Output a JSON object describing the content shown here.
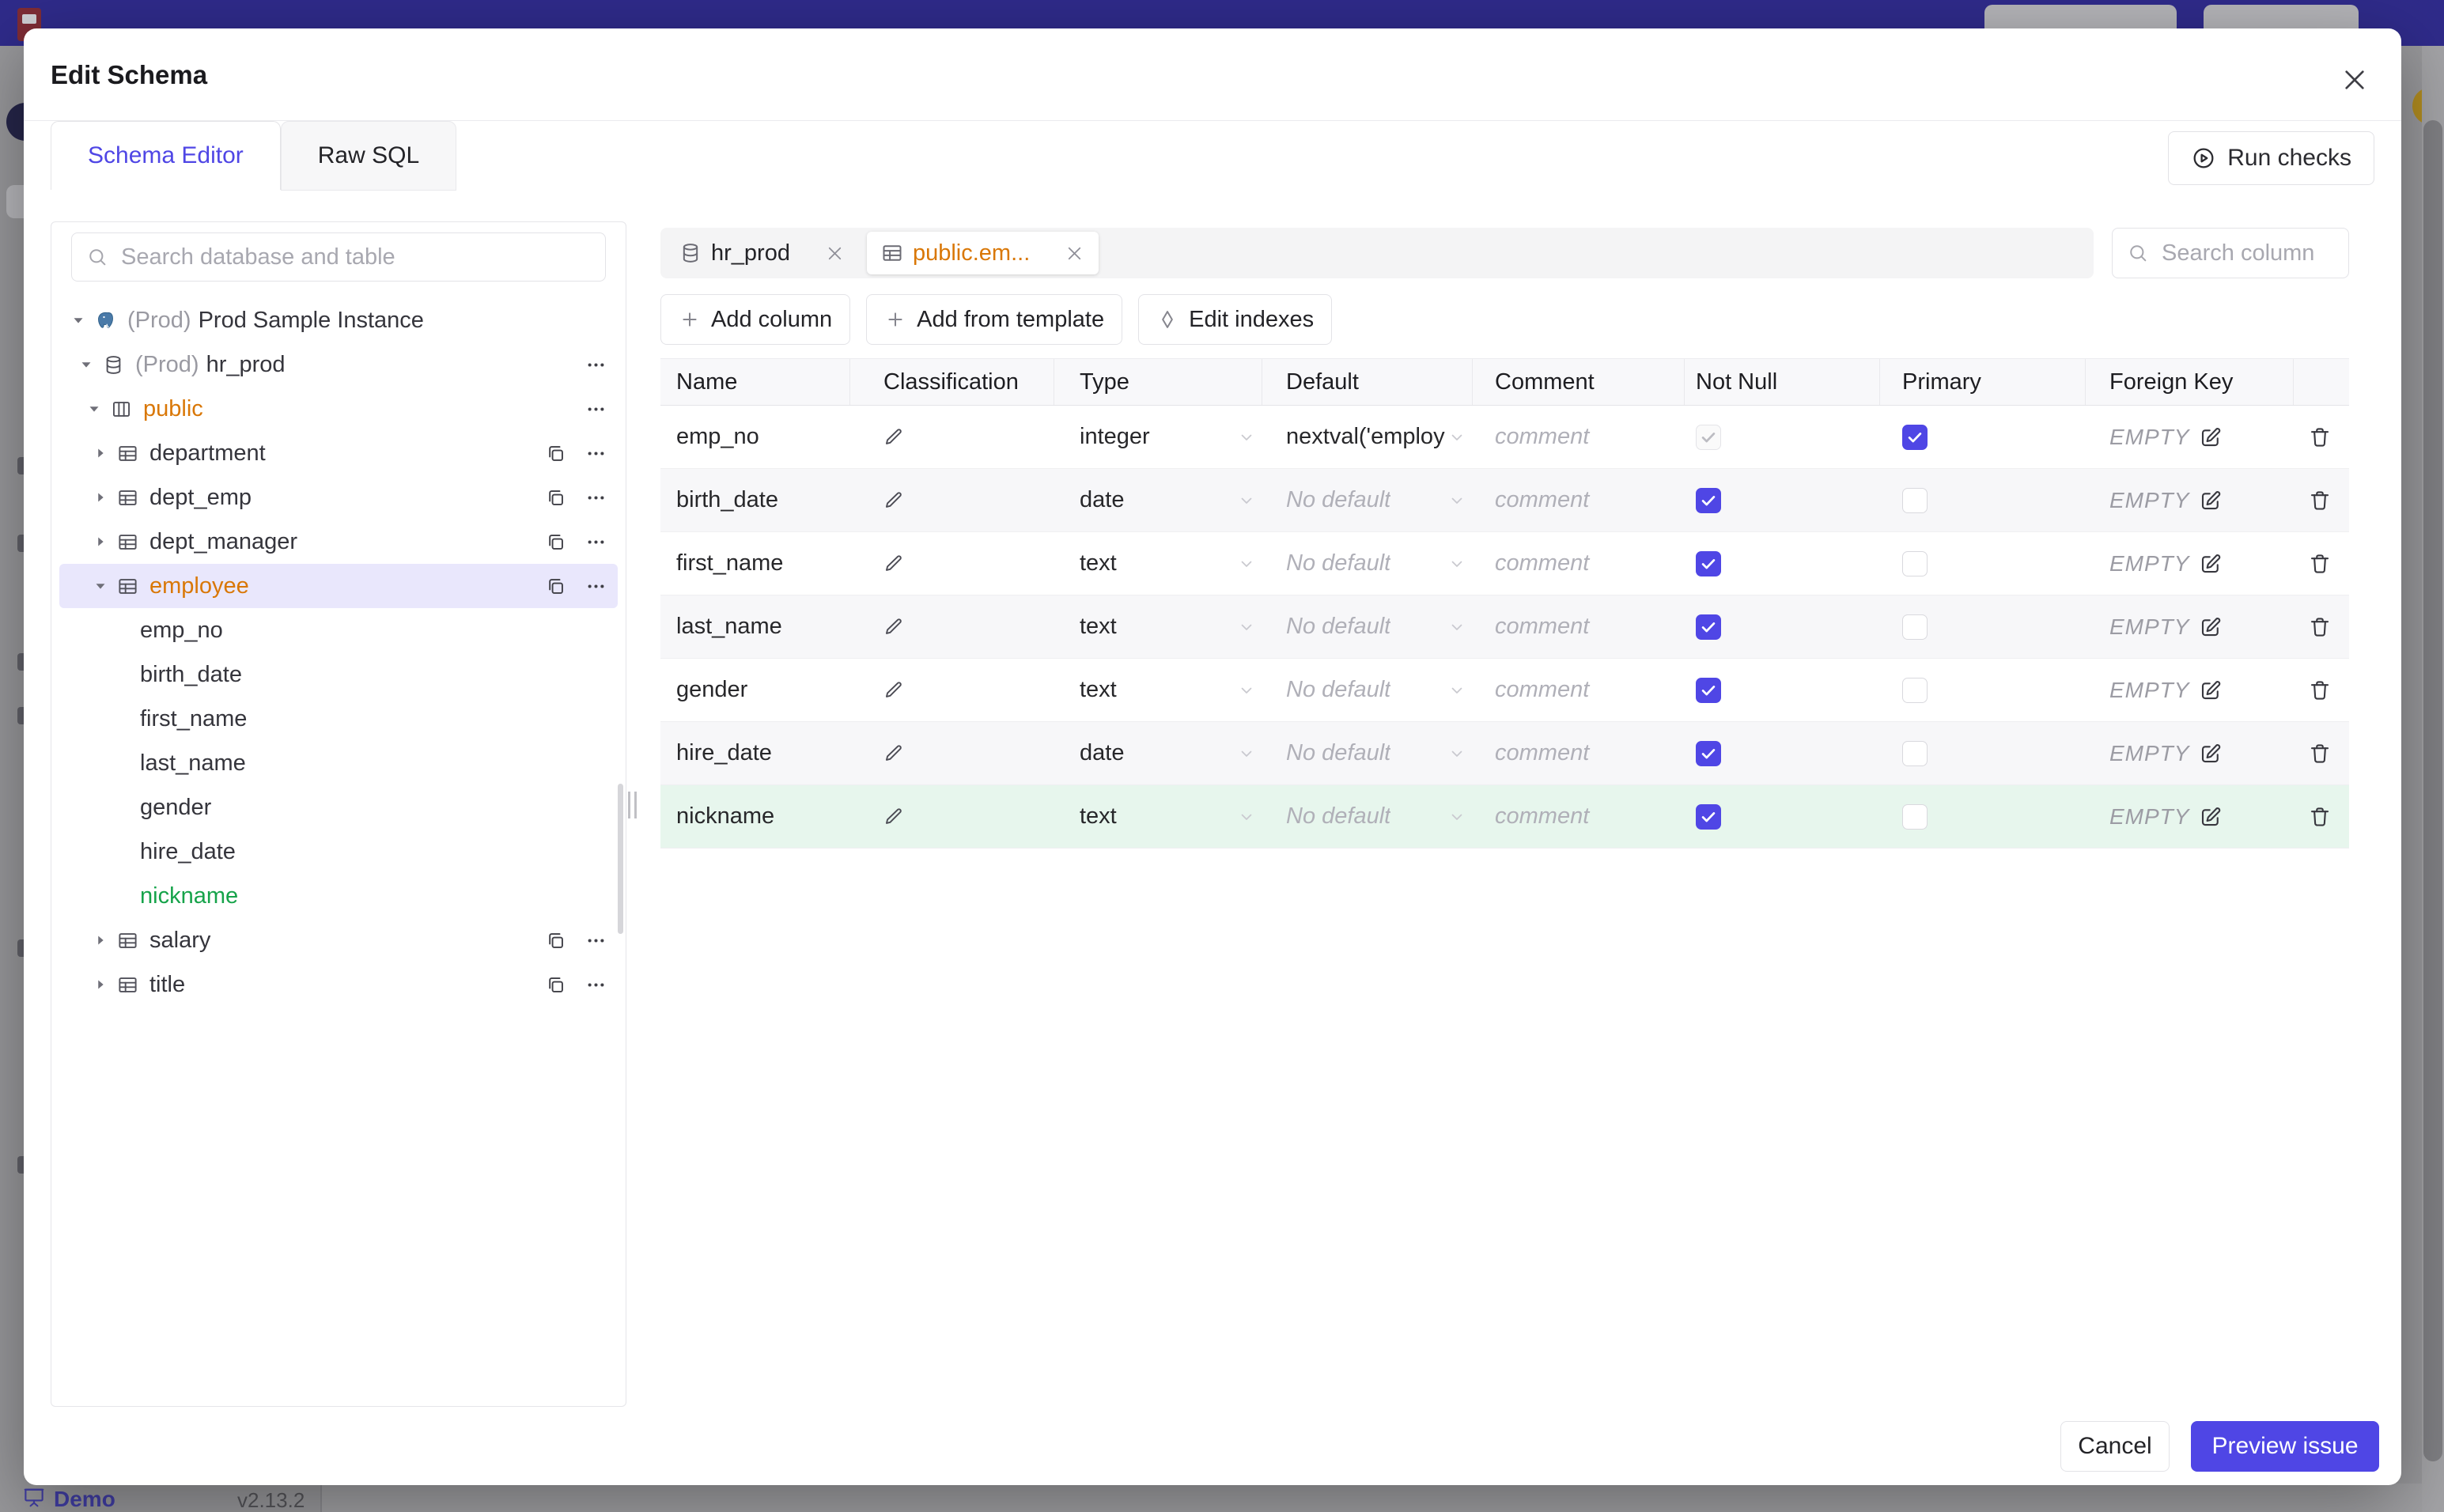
{
  "backdrop": {
    "demo_label": "Demo",
    "version": "v2.13.2"
  },
  "modal": {
    "title": "Edit Schema",
    "tabs": {
      "schema_editor": "Schema Editor",
      "raw_sql": "Raw SQL"
    },
    "run_checks_label": "Run checks",
    "cancel_label": "Cancel",
    "preview_issue_label": "Preview issue"
  },
  "sidebar": {
    "search_placeholder": "Search database and table",
    "tree": [
      {
        "id": "prod-sample-instance",
        "level": 0,
        "kind": "instance",
        "icon": "postgres",
        "prefix": "(Prod)",
        "label": "Prod Sample Instance",
        "expanded": true
      },
      {
        "id": "hr-prod",
        "level": 1,
        "kind": "database",
        "icon": "database",
        "prefix": "(Prod)",
        "label": "hr_prod",
        "expanded": true,
        "more": true
      },
      {
        "id": "public",
        "level": 2,
        "kind": "schema",
        "icon": "schema",
        "label": "public",
        "expanded": true,
        "more": true,
        "color": "amber"
      },
      {
        "id": "department",
        "level": 3,
        "kind": "table",
        "icon": "table",
        "label": "department",
        "expanded": false,
        "copy": true,
        "more": true
      },
      {
        "id": "dept-emp",
        "level": 3,
        "kind": "table",
        "icon": "table",
        "label": "dept_emp",
        "expanded": false,
        "copy": true,
        "more": true
      },
      {
        "id": "dept-manager",
        "level": 3,
        "kind": "table",
        "icon": "table",
        "label": "dept_manager",
        "expanded": false,
        "copy": true,
        "more": true
      },
      {
        "id": "employee",
        "level": 3,
        "kind": "table",
        "icon": "table",
        "label": "employee",
        "expanded": true,
        "copy": true,
        "more": true,
        "color": "amber",
        "selected": true
      },
      {
        "id": "col-emp-no",
        "level": 4,
        "kind": "column",
        "label": "emp_no"
      },
      {
        "id": "col-birth-date",
        "level": 4,
        "kind": "column",
        "label": "birth_date"
      },
      {
        "id": "col-first-name",
        "level": 4,
        "kind": "column",
        "label": "first_name"
      },
      {
        "id": "col-last-name",
        "level": 4,
        "kind": "column",
        "label": "last_name"
      },
      {
        "id": "col-gender",
        "level": 4,
        "kind": "column",
        "label": "gender"
      },
      {
        "id": "col-hire-date",
        "level": 4,
        "kind": "column",
        "label": "hire_date"
      },
      {
        "id": "col-nickname",
        "level": 4,
        "kind": "column",
        "label": "nickname",
        "color": "green"
      },
      {
        "id": "salary",
        "level": 3,
        "kind": "table",
        "icon": "table",
        "label": "salary",
        "expanded": false,
        "copy": true,
        "more": true
      },
      {
        "id": "title",
        "level": 3,
        "kind": "table",
        "icon": "table",
        "label": "title",
        "expanded": false,
        "copy": true,
        "more": true
      }
    ]
  },
  "editor": {
    "tabs": [
      {
        "label": "hr_prod",
        "icon": "database",
        "active": false
      },
      {
        "label": "public.em...",
        "icon": "table",
        "active": true
      }
    ],
    "toolbar": {
      "add_column_label": "Add column",
      "add_from_template_label": "Add from template",
      "edit_indexes_label": "Edit indexes"
    },
    "search_placeholder": "Search column",
    "table": {
      "headers": [
        "Name",
        "Classification",
        "Type",
        "Default",
        "Comment",
        "Not Null",
        "Primary",
        "Foreign Key",
        ""
      ],
      "comment_placeholder": "comment",
      "foreign_key_empty_label": "EMPTY",
      "rows": [
        {
          "name": "emp_no",
          "type": "integer",
          "default": "nextval('employ",
          "default_is_placeholder": false,
          "not_null": true,
          "not_null_disabled": true,
          "primary": true,
          "is_new": false
        },
        {
          "name": "birth_date",
          "type": "date",
          "default": "No default",
          "default_is_placeholder": true,
          "not_null": true,
          "not_null_disabled": false,
          "primary": false,
          "is_new": false
        },
        {
          "name": "first_name",
          "type": "text",
          "default": "No default",
          "default_is_placeholder": true,
          "not_null": true,
          "not_null_disabled": false,
          "primary": false,
          "is_new": false
        },
        {
          "name": "last_name",
          "type": "text",
          "default": "No default",
          "default_is_placeholder": true,
          "not_null": true,
          "not_null_disabled": false,
          "primary": false,
          "is_new": false
        },
        {
          "name": "gender",
          "type": "text",
          "default": "No default",
          "default_is_placeholder": true,
          "not_null": true,
          "not_null_disabled": false,
          "primary": false,
          "is_new": false
        },
        {
          "name": "hire_date",
          "type": "date",
          "default": "No default",
          "default_is_placeholder": true,
          "not_null": true,
          "not_null_disabled": false,
          "primary": false,
          "is_new": false
        },
        {
          "name": "nickname",
          "type": "text",
          "default": "No default",
          "default_is_placeholder": true,
          "not_null": true,
          "not_null_disabled": false,
          "primary": false,
          "is_new": true
        }
      ]
    }
  },
  "colors": {
    "accent_indigo": "#4f46e5",
    "amber": "#d97706",
    "green": "#16a34a",
    "selection_bg": "#e9e7fc",
    "new_row_bg": "#e7f6ed",
    "banner": "#2f2b8a"
  }
}
